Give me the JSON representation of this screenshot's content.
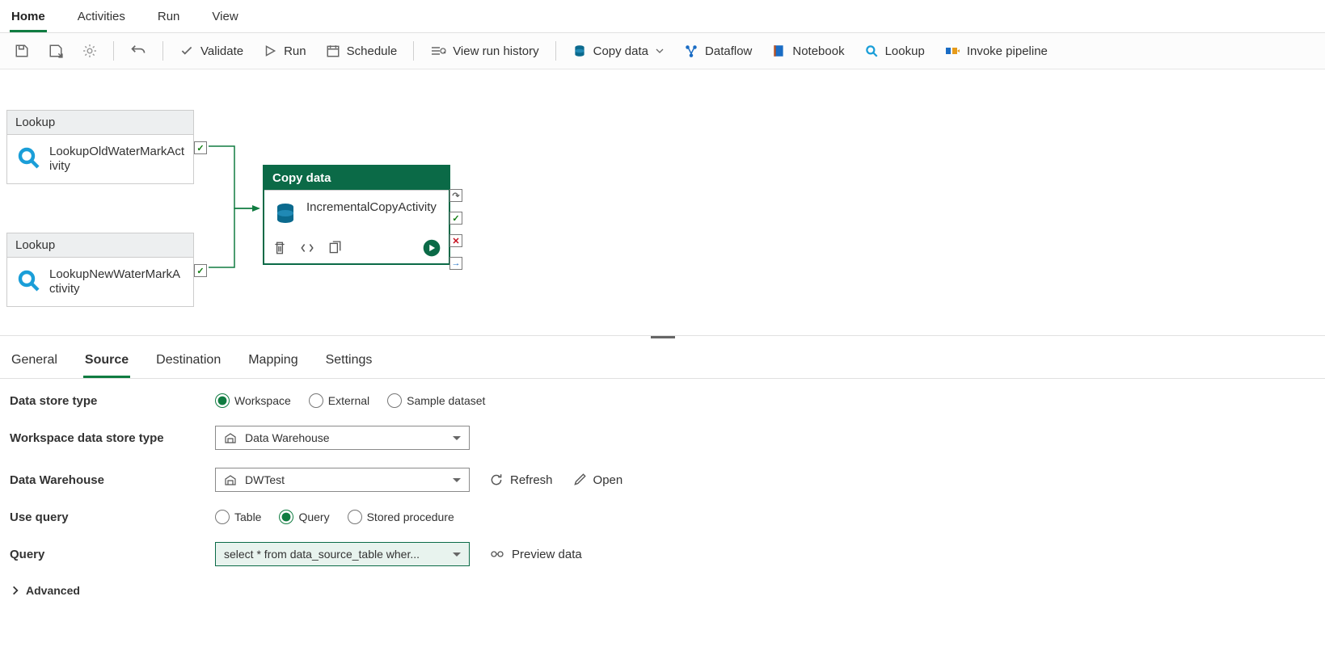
{
  "topTabs": [
    "Home",
    "Activities",
    "Run",
    "View"
  ],
  "toolbar": {
    "validate": "Validate",
    "run": "Run",
    "schedule": "Schedule",
    "history": "View run history",
    "copydata": "Copy data",
    "dataflow": "Dataflow",
    "notebook": "Notebook",
    "lookup": "Lookup",
    "invoke": "Invoke pipeline"
  },
  "nodes": {
    "lookup1": {
      "type": "Lookup",
      "name": "LookupOldWaterMarkActivity"
    },
    "lookup2": {
      "type": "Lookup",
      "name": "LookupNewWaterMarkActivity"
    },
    "copy": {
      "type": "Copy data",
      "name": "IncrementalCopyActivity"
    }
  },
  "propTabs": [
    "General",
    "Source",
    "Destination",
    "Mapping",
    "Settings"
  ],
  "form": {
    "dataStoreType": "Data store type",
    "dsOptions": [
      "Workspace",
      "External",
      "Sample dataset"
    ],
    "workspaceDST": "Workspace data store type",
    "workspaceDSTValue": "Data Warehouse",
    "dataWarehouse": "Data Warehouse",
    "dataWarehouseValue": "DWTest",
    "refresh": "Refresh",
    "open": "Open",
    "useQuery": "Use query",
    "uqOptions": [
      "Table",
      "Query",
      "Stored procedure"
    ],
    "query": "Query",
    "queryValue": "select * from data_source_table wher...",
    "preview": "Preview data",
    "advanced": "Advanced"
  }
}
